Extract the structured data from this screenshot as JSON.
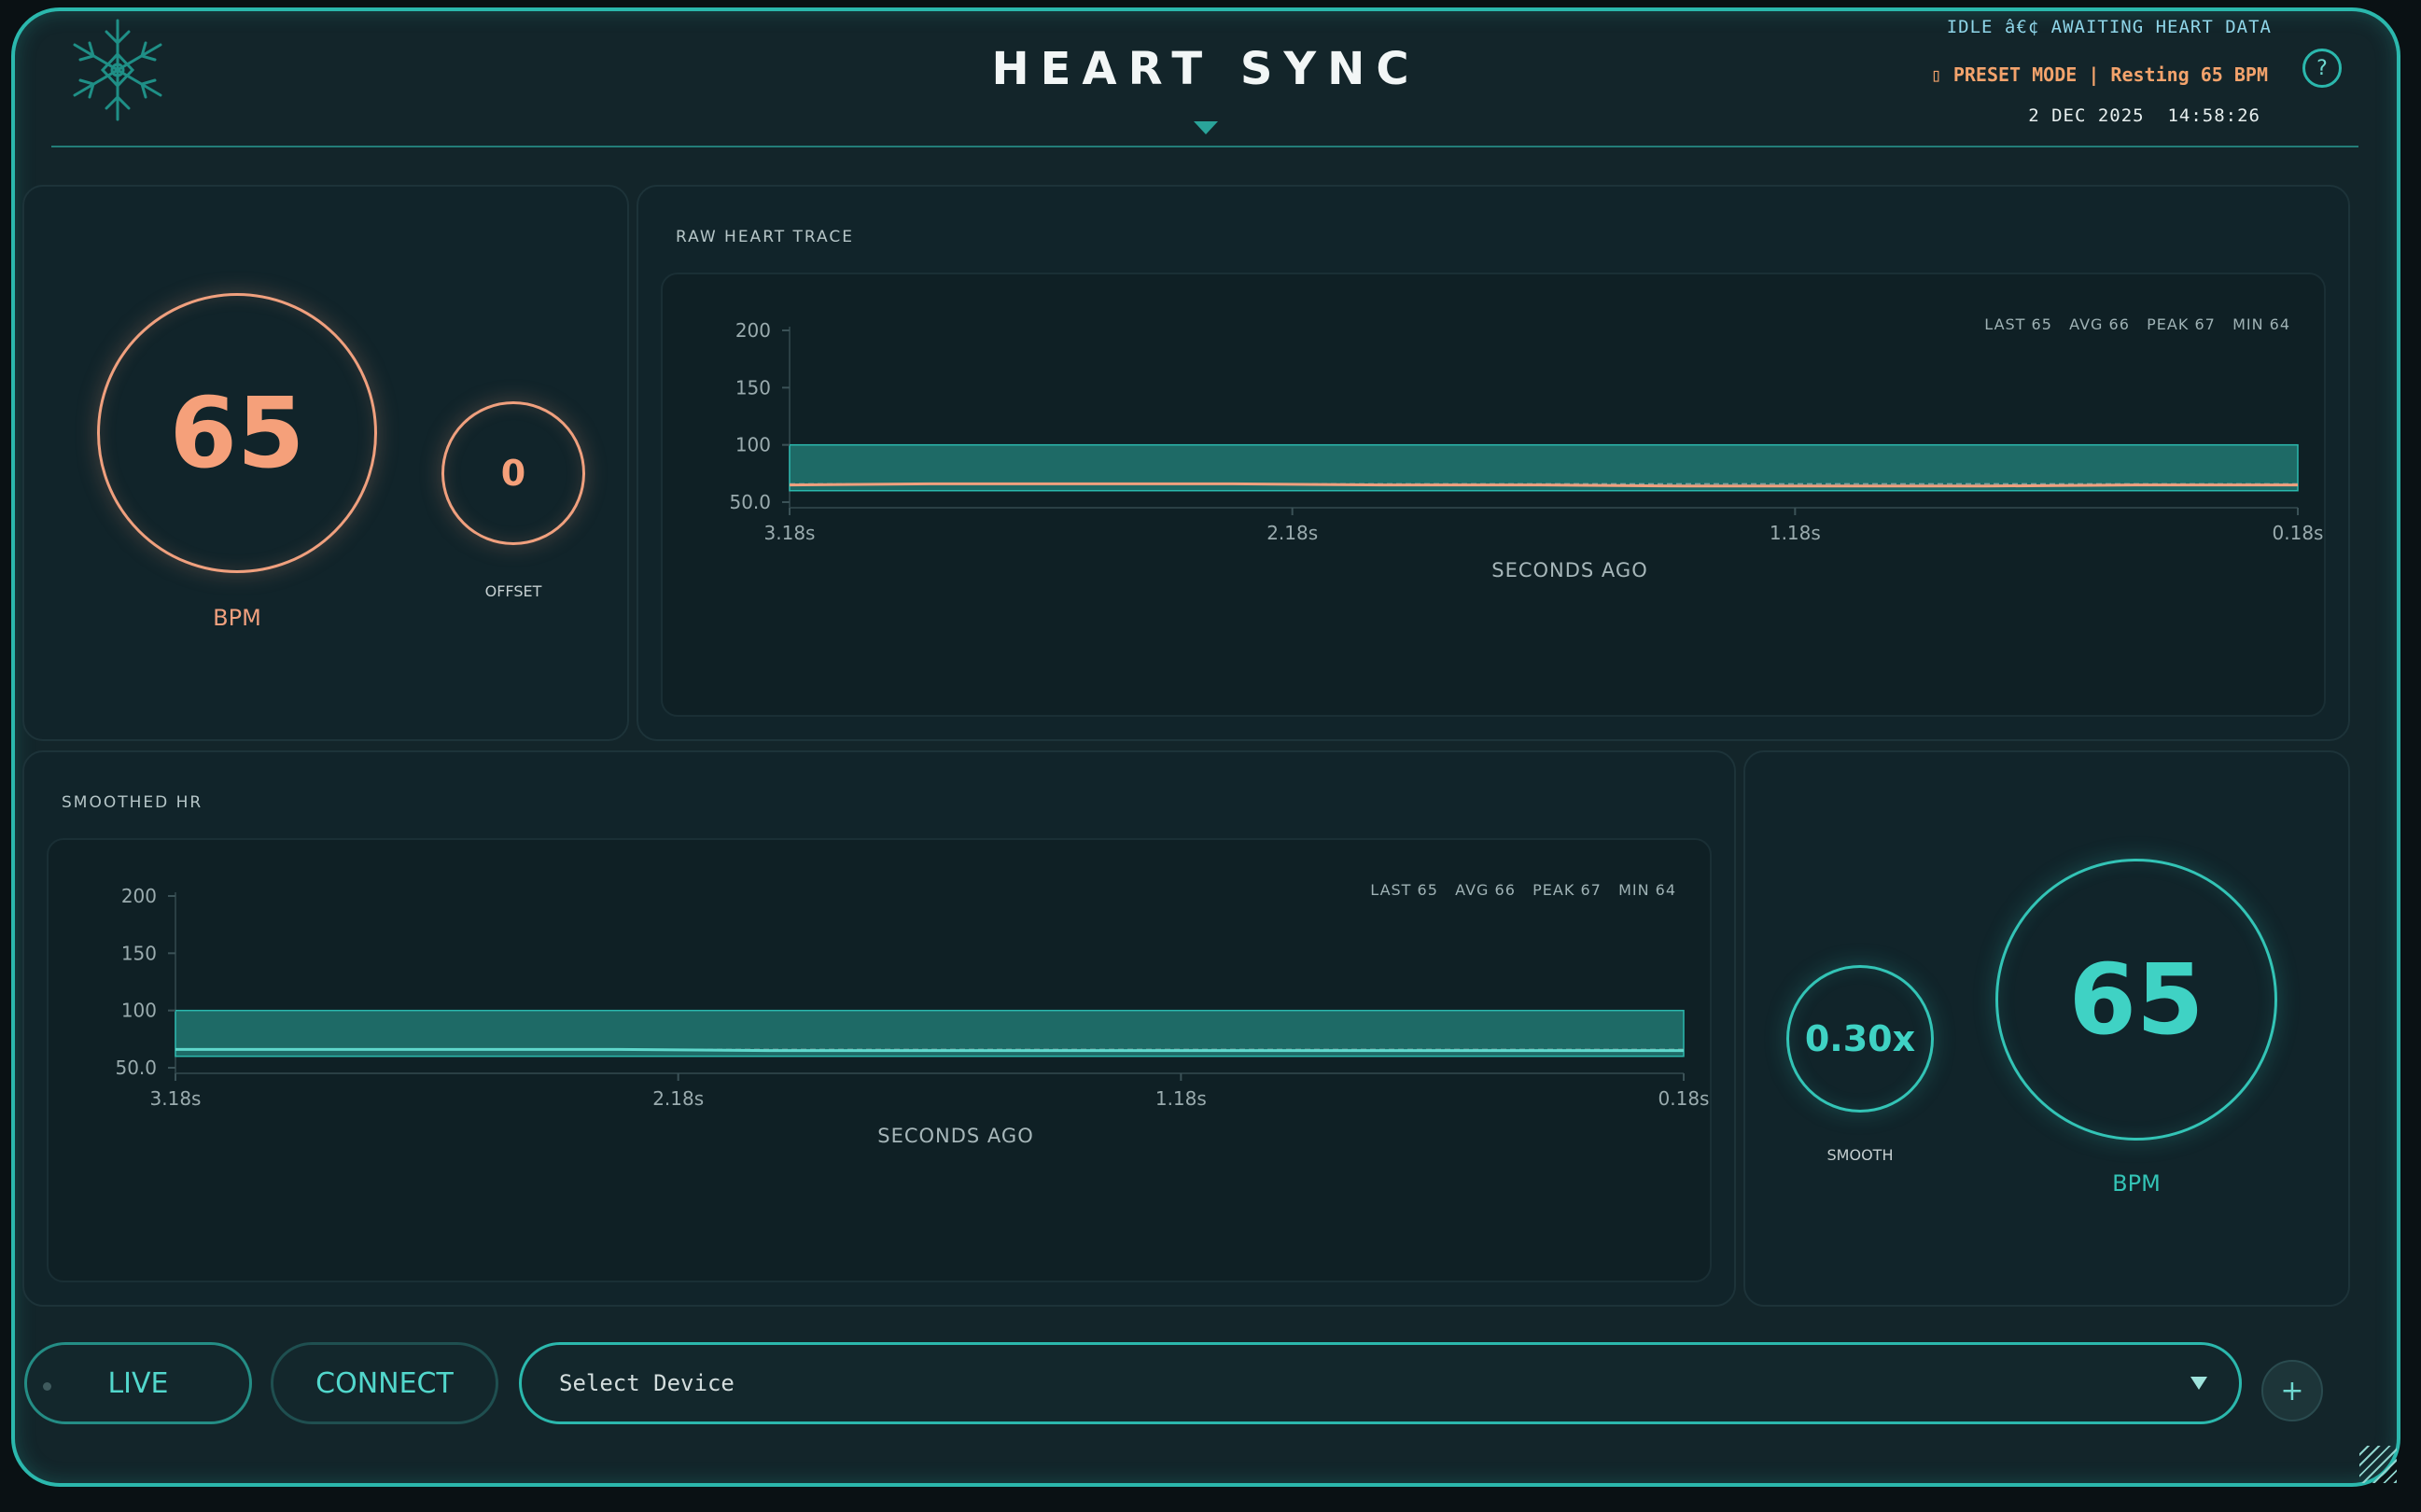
{
  "header": {
    "title": "HEART SYNC",
    "status": "IDLE â€¢ AWAITING HEART DATA",
    "mode": "▯ PRESET MODE | Resting 65 BPM",
    "date": "2 DEC 2025",
    "time": "14:58:26",
    "help_label": "?",
    "icons": {
      "logo": "snowflake-emblem-icon",
      "help": "question-icon",
      "collapse": "triangle-down-icon"
    }
  },
  "raw": {
    "bpm_value": "65",
    "bpm_label": "BPM",
    "offset_value": "0",
    "offset_label": "OFFSET"
  },
  "smooth": {
    "factor_value": "0.30x",
    "factor_label": "SMOOTH",
    "bpm_value": "65",
    "bpm_label": "BPM"
  },
  "controls": {
    "live_label": "LIVE",
    "connect_label": "CONNECT",
    "device_value": "Select Device",
    "add_label": "+",
    "icons": {
      "device_dropdown": "triangle-down-icon",
      "add": "plus-icon"
    }
  },
  "colors": {
    "accent": "#2bb8ad",
    "raw_accent": "#f0a07e",
    "smooth_accent": "#33c4b6",
    "band": "#1e6a66",
    "background": "#13252a"
  },
  "chart_data": [
    {
      "type": "line",
      "title": "RAW HEART TRACE",
      "xlabel": "SECONDS AGO",
      "ylabel": "",
      "x_ticks": [
        "3.18s",
        "2.18s",
        "1.18s",
        "0.18s"
      ],
      "y_ticks": [
        "50.0",
        "100",
        "150",
        "200"
      ],
      "xlim": [
        3.18,
        0.18
      ],
      "ylim": [
        50,
        210
      ],
      "band": [
        60,
        100
      ],
      "grid": false,
      "stats": {
        "last": "LAST 65",
        "avg": "AVG 66",
        "peak": "PEAK 67",
        "min": "MIN 64"
      },
      "series": [
        {
          "color": "#f0a07e",
          "x": [
            3.18,
            2.9,
            2.6,
            2.3,
            2.0,
            1.7,
            1.4,
            1.1,
            0.8,
            0.5,
            0.18
          ],
          "y": [
            65,
            66,
            66,
            66,
            65,
            65,
            64,
            64,
            64,
            65,
            65
          ]
        }
      ]
    },
    {
      "type": "line",
      "title": "SMOOTHED HR",
      "xlabel": "SECONDS AGO",
      "ylabel": "",
      "x_ticks": [
        "3.18s",
        "2.18s",
        "1.18s",
        "0.18s"
      ],
      "y_ticks": [
        "50.0",
        "100",
        "150",
        "200"
      ],
      "xlim": [
        3.18,
        0.18
      ],
      "ylim": [
        50,
        210
      ],
      "band": [
        60,
        100
      ],
      "grid": false,
      "stats": {
        "last": "LAST 65",
        "avg": "AVG 66",
        "peak": "PEAK 67",
        "min": "MIN 64"
      },
      "series": [
        {
          "color": "#5fd8cc",
          "x": [
            3.18,
            2.9,
            2.6,
            2.3,
            2.0,
            1.7,
            1.4,
            1.1,
            0.8,
            0.5,
            0.18
          ],
          "y": [
            66,
            66,
            66,
            66,
            65,
            65,
            65,
            65,
            65,
            65,
            65
          ]
        }
      ]
    }
  ]
}
